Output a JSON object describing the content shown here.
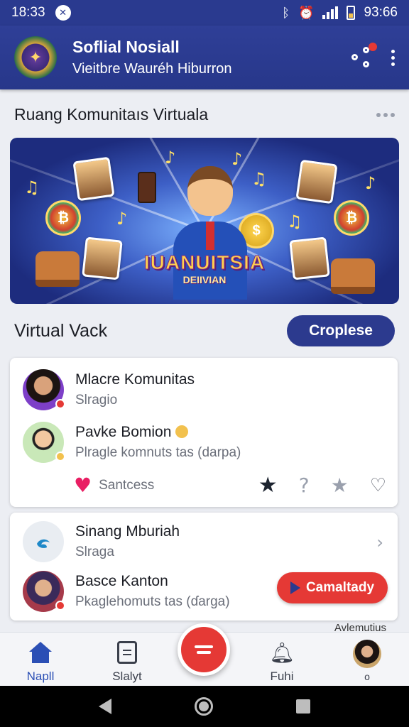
{
  "status_bar": {
    "time": "18:33",
    "time_right": "93:66",
    "app_badge": "✕"
  },
  "header": {
    "title": "Soflial Nosiall",
    "subtitle": "Vieitbre Wauréh Hiburron"
  },
  "section": {
    "title": "Ruang Komunitaıs Virtuala"
  },
  "banner": {
    "title": "IUANUITSIA",
    "subtitle": "DEIIVIAN"
  },
  "virtual_row": {
    "label": "Virtual Vack",
    "button_label": "Croplese"
  },
  "card1": {
    "items": [
      {
        "title": "Mlacre Komunitas",
        "subtitle": "Slragio"
      },
      {
        "title": "Pavke Bomion",
        "subtitle": "Plragle komnuts tas (darpa)"
      }
    ],
    "action_label": "Santcess",
    "action_icons": [
      "heart-filled-icon",
      "star-filled-icon",
      "question-icon",
      "star-outline-icon",
      "heart-outline-icon"
    ]
  },
  "card2": {
    "items": [
      {
        "title": "Sinang Mburiah",
        "subtitle": "Slraga"
      },
      {
        "title": "Basce Kanton",
        "subtitle": "Pkaglehomuts tas (ɗarga)"
      }
    ],
    "button_label": "Camaltady"
  },
  "peek_text": "Avlemutius",
  "bottom_nav": {
    "items": [
      {
        "label": "Napll",
        "icon": "home-icon",
        "active": true
      },
      {
        "label": "Slalyt",
        "icon": "document-icon",
        "active": false
      },
      {
        "label": "Fuhi",
        "icon": "bell-icon",
        "active": false
      },
      {
        "label": "o",
        "icon": "profile-avatar",
        "active": false
      }
    ]
  },
  "colors": {
    "primary": "#2c3a8e",
    "accent": "#e53935",
    "background": "#eceef3"
  }
}
